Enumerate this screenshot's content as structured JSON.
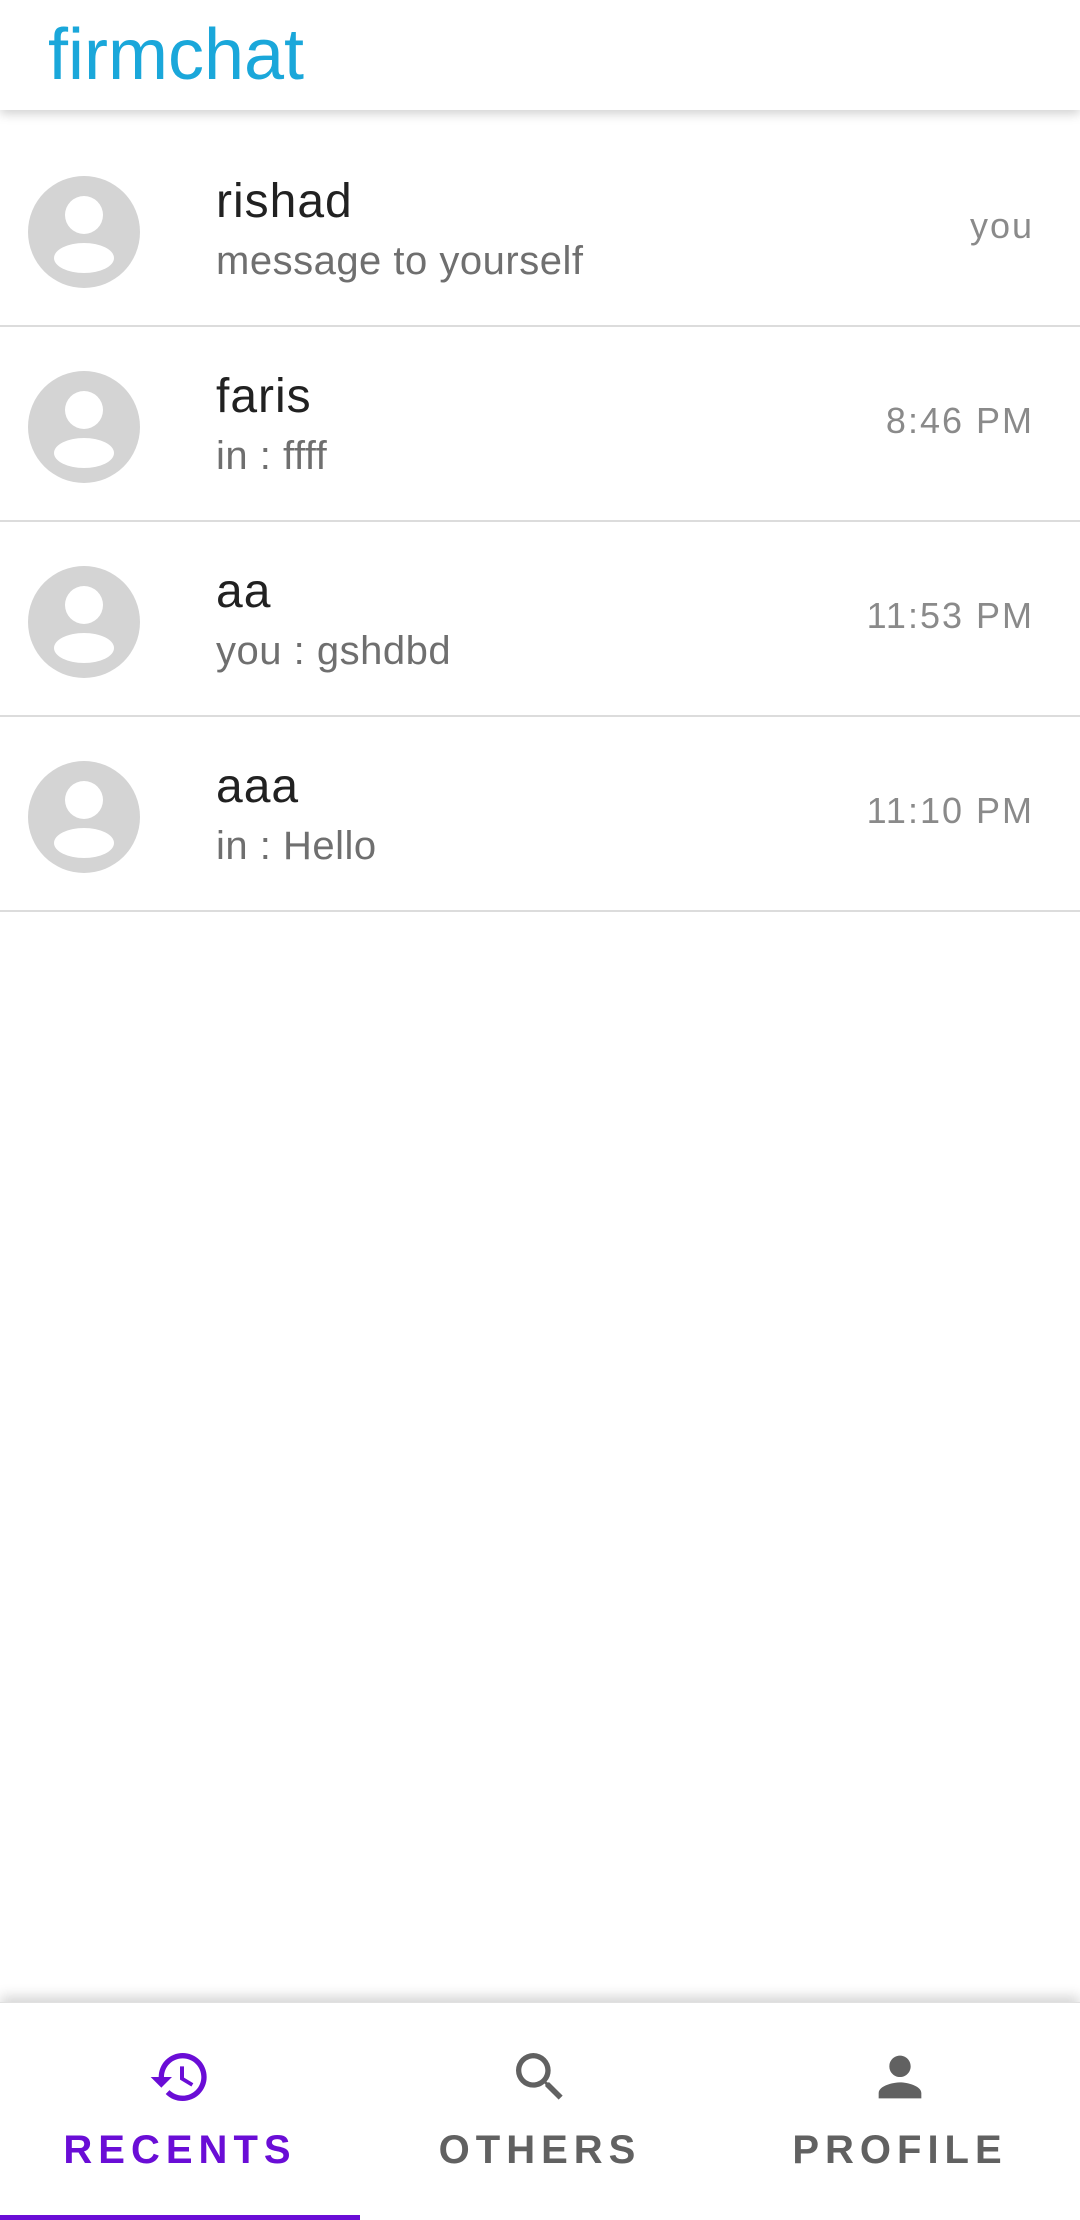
{
  "app": {
    "title": "firmchat",
    "brand_color": "#1aa7da",
    "accent_color": "#6a0dd6"
  },
  "chats": [
    {
      "name": "rishad",
      "preview": "message to yourself",
      "time": "you"
    },
    {
      "name": "faris",
      "preview": "in : ffff",
      "time": "8:46 PM"
    },
    {
      "name": "aa",
      "preview": "you : gshdbd",
      "time": "11:53 PM"
    },
    {
      "name": "aaa",
      "preview": "in : Hello",
      "time": "11:10 PM"
    }
  ],
  "bottom_nav": {
    "tabs": [
      {
        "label": "RECENTS",
        "icon": "history-icon",
        "active": true
      },
      {
        "label": "OTHERS",
        "icon": "search-icon",
        "active": false
      },
      {
        "label": "PROFILE",
        "icon": "person-icon",
        "active": false
      }
    ]
  }
}
